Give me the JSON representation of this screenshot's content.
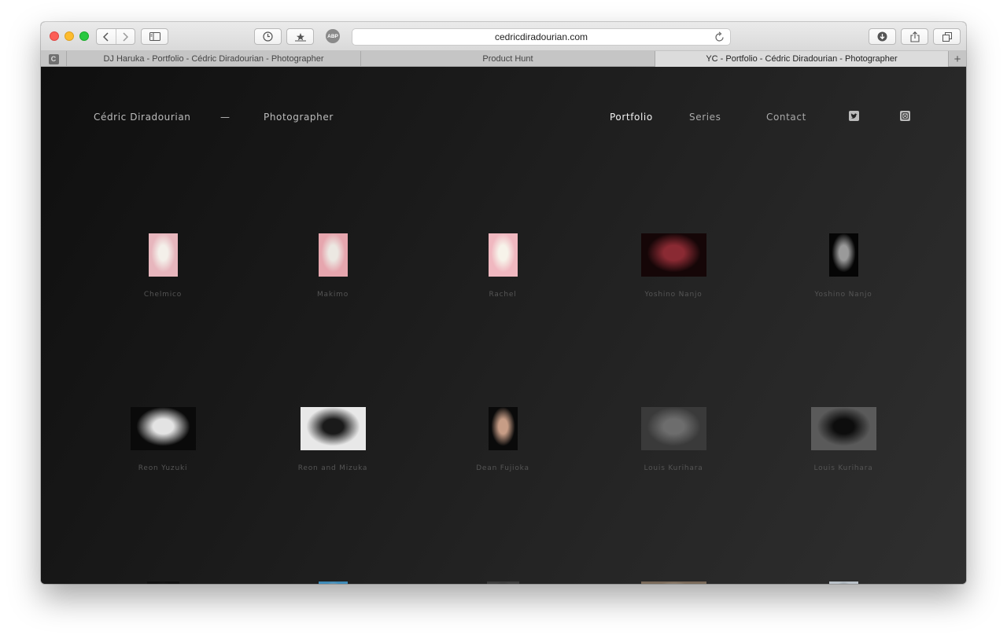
{
  "browser": {
    "url": "cedricdiradourian.com",
    "pinned_tab_letter": "C",
    "tabs": [
      {
        "label": "DJ Haruka - Portfolio - Cédric Diradourian - Photographer",
        "active": false
      },
      {
        "label": "Product Hunt",
        "active": false
      },
      {
        "label": "YC - Portfolio - Cédric Diradourian - Photographer",
        "active": true
      }
    ],
    "abp_label": "ABP",
    "new_tab_glyph": "+",
    "icons": [
      "back-icon",
      "forward-icon",
      "sidebar-icon",
      "history-icon",
      "bookmark-icon",
      "adblock-icon",
      "reload-icon",
      "download-icon",
      "share-icon",
      "tabs-overview-icon"
    ]
  },
  "site": {
    "brand_name": "Cédric Diradourian",
    "brand_dash": "—",
    "brand_role": "Photographer",
    "menu": {
      "portfolio": "Portfolio",
      "series": "Series",
      "contact": "Contact"
    },
    "social": [
      "twitter-icon",
      "instagram-icon"
    ]
  },
  "gallery": [
    {
      "caption": "Chelmico",
      "palette": [
        "#e7b6bd",
        "#f4f0ea"
      ]
    },
    {
      "caption": "Makimo",
      "palette": [
        "#e6a6ae",
        "#ece8e2"
      ]
    },
    {
      "caption": "Rachel",
      "palette": [
        "#f0b8c0",
        "#f7f3ea"
      ]
    },
    {
      "caption": "Yoshino Nanjo",
      "palette": [
        "#150607",
        "#8a2a33"
      ]
    },
    {
      "caption": "Yoshino Nanjo",
      "palette": [
        "#050505",
        "#9a9a9a"
      ]
    },
    {
      "caption": "Reon Yuzuki",
      "palette": [
        "#0a0a0a",
        "#e3e3e3"
      ]
    },
    {
      "caption": "Reon and Mizuka",
      "palette": [
        "#e8e8e8",
        "#1a1a1a"
      ]
    },
    {
      "caption": "Dean Fujioka",
      "palette": [
        "#0a0a0a",
        "#c79d86"
      ]
    },
    {
      "caption": "Louis Kurihara",
      "palette": [
        "#3a3a3a",
        "#6d6d6d"
      ]
    },
    {
      "caption": "Louis Kurihara",
      "palette": [
        "#5a5a5a",
        "#0d0d0d"
      ]
    },
    {
      "caption": "",
      "palette": [
        "#111111",
        "#2c2c2c"
      ]
    },
    {
      "caption": "",
      "palette": [
        "#3f8bb8",
        "#e6c9b3"
      ]
    },
    {
      "caption": "",
      "palette": [
        "#3d3d3d",
        "#111111"
      ]
    },
    {
      "caption": "",
      "palette": [
        "#7a6a5a",
        "#d9d2c7"
      ]
    },
    {
      "caption": "",
      "palette": [
        "#b9c1c8",
        "#3a3f45"
      ]
    }
  ]
}
